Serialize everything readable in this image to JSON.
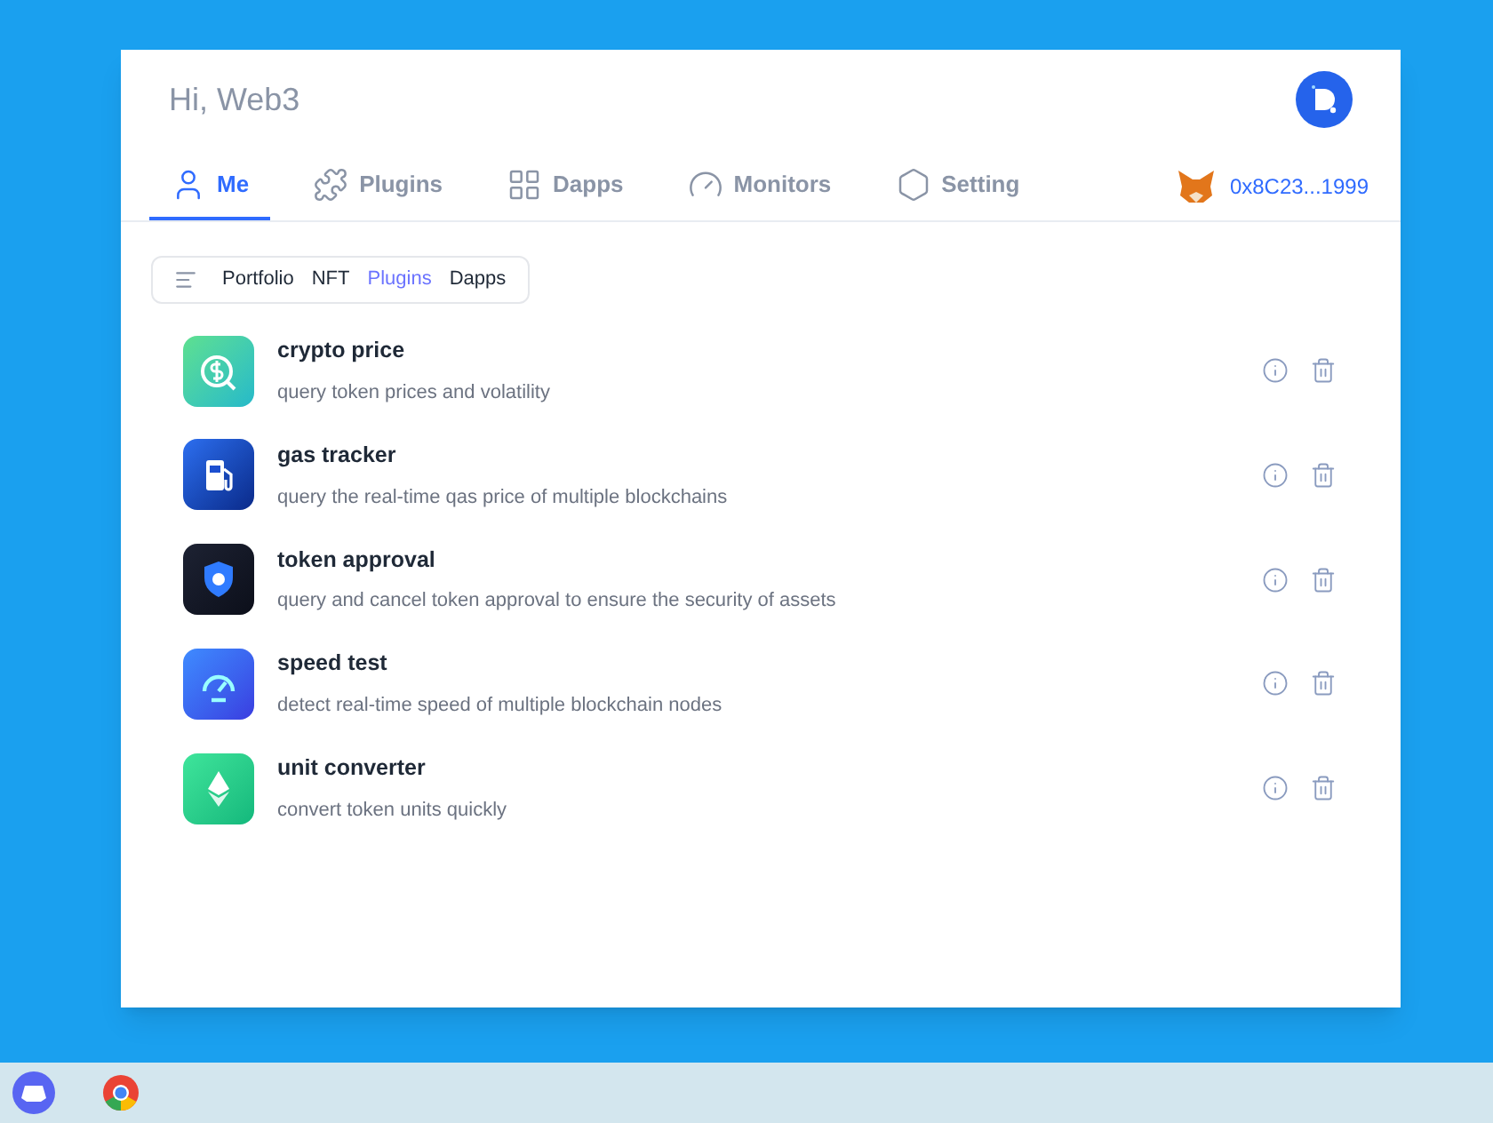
{
  "greeting": "Hi, Web3",
  "tabs": [
    {
      "kind": "user",
      "label": "Me",
      "selected": true
    },
    {
      "kind": "puzzle",
      "label": "Plugins",
      "selected": false
    },
    {
      "kind": "grid",
      "label": "Dapps",
      "selected": false
    },
    {
      "kind": "gauge",
      "label": "Monitors",
      "selected": false
    },
    {
      "kind": "hex",
      "label": "Setting",
      "selected": false
    }
  ],
  "wallet": {
    "address": "0x8C23...1999"
  },
  "filters": [
    {
      "label": "Portfolio",
      "selected": false
    },
    {
      "label": "NFT",
      "selected": false
    },
    {
      "label": "Plugins",
      "selected": true
    },
    {
      "label": "Dapps",
      "selected": false
    }
  ],
  "plugins": [
    {
      "kind": "price",
      "name": "crypto price",
      "description": "query token prices and volatility"
    },
    {
      "kind": "gas",
      "name": "gas tracker",
      "description": "query the real-time qas price of multiple blockchains"
    },
    {
      "kind": "shield",
      "name": "token approval",
      "description": "query and cancel token approval to ensure the security of assets"
    },
    {
      "kind": "speed",
      "name": "speed test",
      "description": "detect real-time speed of multiple blockchain nodes"
    },
    {
      "kind": "eth",
      "name": "unit converter",
      "description": "convert token units quickly"
    }
  ]
}
